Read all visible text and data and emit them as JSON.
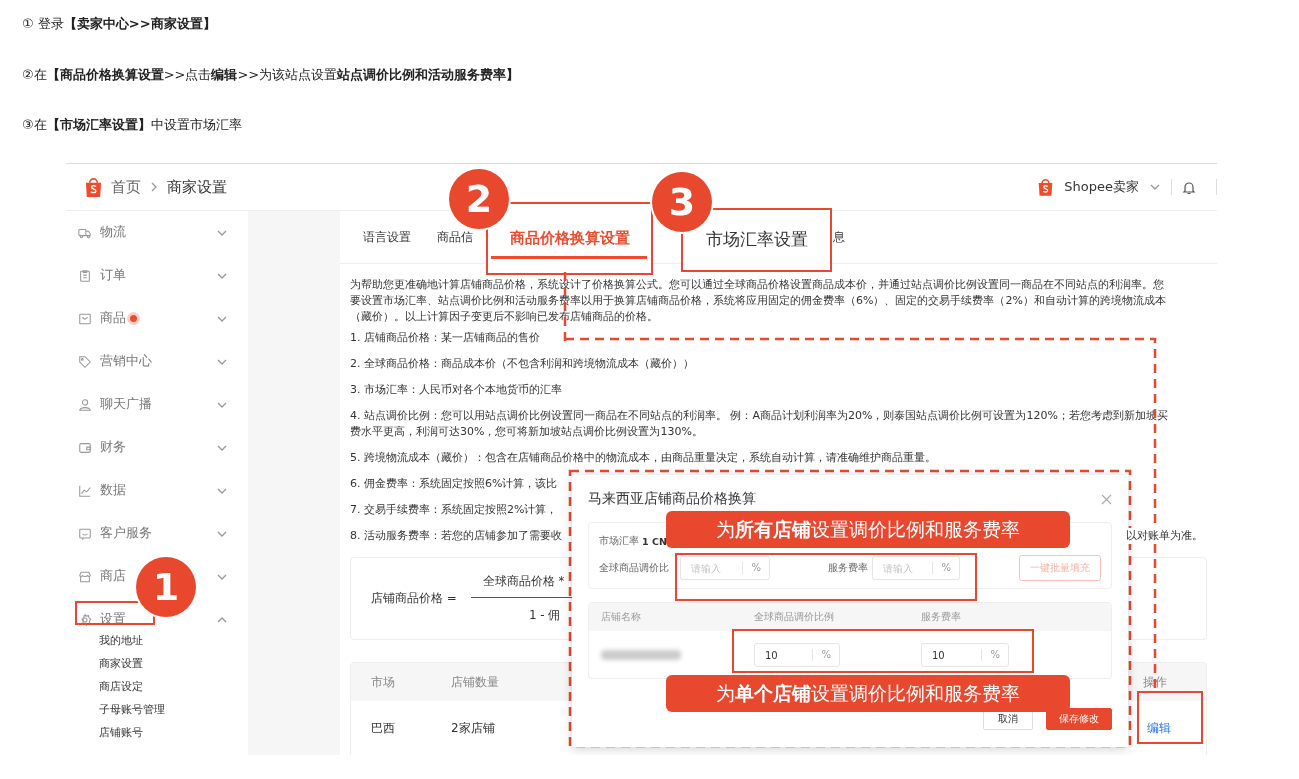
{
  "instructions": [
    "① 登录**【卖家中心>>商家设置】**",
    "②在**【商品价格换算设置**>>点击**编辑**>>为该站点设置**站点调价比例和活动服务费率】**",
    "③在**【市场汇率设置】**中设置市场汇率"
  ],
  "header": {
    "breadcrumb": [
      "首页",
      "商家设置"
    ],
    "account": "Shopee卖家"
  },
  "sidebar": {
    "items": [
      {
        "label": "物流",
        "dot": false,
        "expanded": false
      },
      {
        "label": "订单",
        "dot": false,
        "expanded": false
      },
      {
        "label": "商品",
        "dot": true,
        "expanded": false
      },
      {
        "label": "营销中心",
        "dot": false,
        "expanded": false
      },
      {
        "label": "聊天广播",
        "dot": false,
        "expanded": false
      },
      {
        "label": "财务",
        "dot": false,
        "expanded": false
      },
      {
        "label": "数据",
        "dot": false,
        "expanded": false
      },
      {
        "label": "客户服务",
        "dot": false,
        "expanded": false
      },
      {
        "label": "商店",
        "dot": false,
        "expanded": false
      },
      {
        "label": "设置",
        "dot": false,
        "expanded": true,
        "children": [
          "我的地址",
          "商家设置",
          "商店设定",
          "子母账号管理",
          "店铺账号"
        ]
      }
    ]
  },
  "tabs": [
    {
      "label": "语言设置",
      "selected": false,
      "highlighted": false
    },
    {
      "label": "商品信",
      "selected": false,
      "highlighted": false
    },
    {
      "label": "商品价格换算设置",
      "selected": true,
      "highlighted": true
    },
    {
      "label": "市场汇率设置",
      "selected": false,
      "highlighted": true
    },
    {
      "label": "息",
      "selected": false,
      "highlighted": false
    }
  ],
  "intro": [
    "为帮助您更准确地计算店铺商品价格，系统设计了价格换算公式。您可以通过全球商品价格设置商品成本价，并通过站点调价比例设置同一商品在不同站点的利润率。您",
    "要设置市场汇率、站点调价比例和活动服务费率以用于换算店铺商品价格，系统将应用固定的佣金费率（6%）、固定的交易手续费率（2%）和自动计算的跨境物流成本",
    "（藏价）。以上计算因子变更后不影响已发布店铺商品的价格。"
  ],
  "definitions": [
    {
      "lines": [
        "1. 店铺商品价格：某一店铺商品的售价"
      ]
    },
    {
      "lines": [
        "2. 全球商品价格：商品成本价（不包含利润和跨境物流成本（藏价））"
      ]
    },
    {
      "lines": [
        "3. 市场汇率：人民币对各个本地货币的汇率"
      ]
    },
    {
      "lines": [
        "4. 站点调价比例：您可以用站点调价比例设置同一商品在不同站点的利润率。 例：A商品计划利润率为20%，则泰国站点调价比例可设置为120%；若您考虑到新加坡买",
        "费水平更高，利润可达30%，您可将新加坡站点调价比例设置为130%。"
      ]
    },
    {
      "lines": [
        "5. 跨境物流成本（藏价）：包含在店铺商品价格中的物流成本，由商品重量决定，系统自动计算，请准确维护商品重量。"
      ]
    },
    {
      "lines": [
        "6. 佣金费率：系统固定按照6%计算，该比"
      ]
    },
    {
      "lines": [
        "7. 交易手续费率：系统固定按照2%计算，"
      ]
    },
    {
      "lines": [
        "8. 活动服务费率：若您的店铺参加了需要收"
      ],
      "tail": "以对账单为准。"
    }
  ],
  "formula": {
    "lhs": "店铺商品价格 =",
    "numerator": "全球商品价格 *",
    "denominator": "1 - 佣"
  },
  "table": {
    "columns": [
      "市场",
      "店铺数量",
      "操作"
    ],
    "rows": [
      {
        "cells": [
          "巴西",
          "2家店铺"
        ],
        "action": "编辑"
      }
    ]
  },
  "modal": {
    "title": "马来西亚店铺商品价格换算",
    "rate_label": "市场汇率",
    "rate_value": "1 CN",
    "global_label": "全球商品调价比",
    "global_field": {
      "placeholder": "请输入",
      "unit": "%"
    },
    "fee_label": "服务费率",
    "fee_field": {
      "placeholder": "请输入",
      "unit": "%"
    },
    "bulk_button": {
      "label": "一键批量填充",
      "disabled": true
    },
    "columns": [
      "店铺名称",
      "全球商品调价比例",
      "服务费率"
    ],
    "rows": [
      {
        "global": {
          "value": "10",
          "unit": "%"
        },
        "fee": {
          "value": "10",
          "unit": "%"
        }
      }
    ],
    "buttons": [
      {
        "label": "取消",
        "kind": "secondary"
      },
      {
        "label": "保存修改",
        "kind": "primary"
      }
    ]
  },
  "annotations": {
    "steps": [
      "1",
      "2",
      "3"
    ],
    "banners": [
      "为**所有店铺**设置调价比例和服务费率",
      "为**单个店铺**设置调价比例和服务费率"
    ]
  }
}
